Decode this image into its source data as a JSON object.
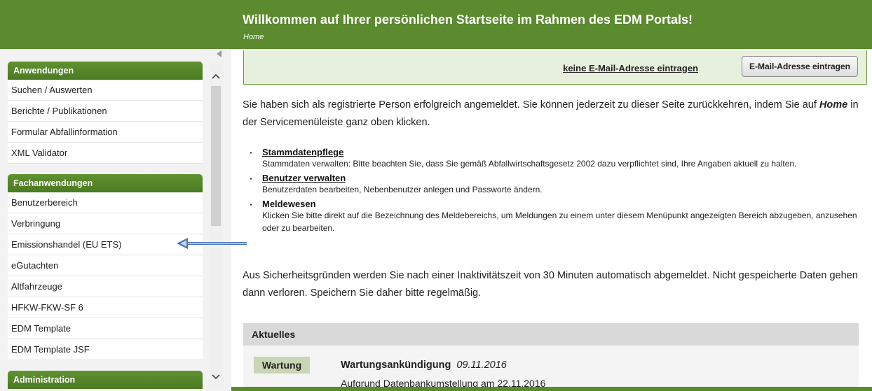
{
  "header": {
    "title": "Willkommen auf Ihrer persönlichen Startseite im Rahmen des EDM Portals!",
    "breadcrumb": "Home"
  },
  "sidebar": {
    "sections": [
      {
        "title": "Anwendungen",
        "items": [
          "Suchen / Auswerten",
          "Berichte / Publikationen",
          "Formular Abfallinformation",
          "XML Validator"
        ]
      },
      {
        "title": "Fachanwendungen",
        "items": [
          "Benutzerbereich",
          "Verbringung",
          "Emissionshandel (EU ETS)",
          "eGutachten",
          "Altfahrzeuge",
          "HFKW-FKW-SF 6",
          "EDM Template",
          "EDM Template JSF"
        ]
      },
      {
        "title": "Administration",
        "items": []
      }
    ]
  },
  "email": {
    "link_label": "keine E-Mail-Adresse eintragen",
    "button_label": "E-Mail-Adresse eintragen"
  },
  "intro": {
    "text_before": "Sie haben sich als registrierte Person erfolgreich angemeldet. Sie können jederzeit zu dieser Seite zurückkehren, indem Sie auf ",
    "emphasis": "Home",
    "text_after": " in der Servicemenüleiste ganz oben klicken."
  },
  "features": [
    {
      "title": "Stammdatenpflege",
      "description": "Stammdaten verwalten: Bitte beachten Sie, dass Sie gemäß Abfallwirtschaftsgesetz 2002 dazu verpflichtet sind, Ihre Angaben aktuell zu halten."
    },
    {
      "title": "Benutzer verwalten",
      "description": "Benutzerdaten bearbeiten, Nebenbenutzer anlegen und Passworte ändern."
    },
    {
      "title": "Meldewesen",
      "description": "Klicken Sie bitte direkt auf die Bezeichnung des Meldebereichs, um Meldungen zu einem unter diesem Menüpunkt angezeigten Bereich abzugeben, anzusehen oder zu bearbeiten."
    }
  ],
  "security_notice": "Aus Sicherheitsgründen werden Sie nach einer Inaktivitätszeit von 30 Minuten automatisch abgemeldet. Nicht gespeicherte Daten gehen dann verloren. Speichern Sie daher bitte regelmäßig.",
  "news": {
    "heading": "Aktuelles",
    "badge": "Wartung",
    "title": "Wartungsankündigung",
    "date": "09.11.2016",
    "text": "Aufgrund Datenbankumstellung am 22.11.2016"
  },
  "colors": {
    "brand_green": "#5b8a2f",
    "section_green": "#4a7a22",
    "email_box_bg": "#e6f0dc",
    "arrow_blue": "#4a76b4"
  }
}
